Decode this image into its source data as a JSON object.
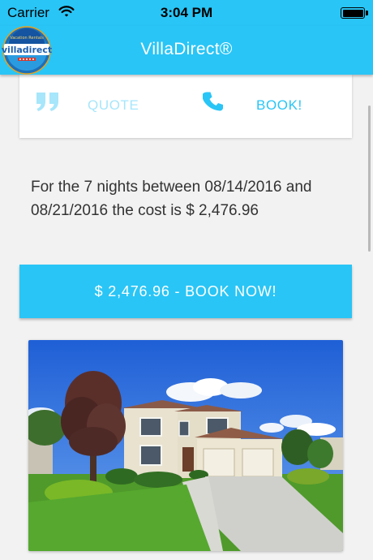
{
  "status_bar": {
    "carrier": "Carrier",
    "time": "3:04 PM",
    "wifi_icon": "wifi-icon",
    "battery_icon": "battery-icon"
  },
  "nav": {
    "title": "VillaDirect®",
    "logo_text": "villadirect",
    "logo_arc_text": "Vacation Rentals"
  },
  "actions": {
    "quote_label": "QUOTE",
    "book_label": "BOOK!",
    "quote_icon": "quote-icon",
    "phone_icon": "phone-icon"
  },
  "pricing": {
    "summary": "For the 7 nights between 08/14/2016 and 08/21/2016 the cost is $ 2,476.96",
    "book_now_button": "$ 2,476.96 - BOOK NOW!"
  },
  "colors": {
    "brand": "#29c5f6",
    "quote_faded": "#a7e6fb",
    "text": "#333333"
  }
}
